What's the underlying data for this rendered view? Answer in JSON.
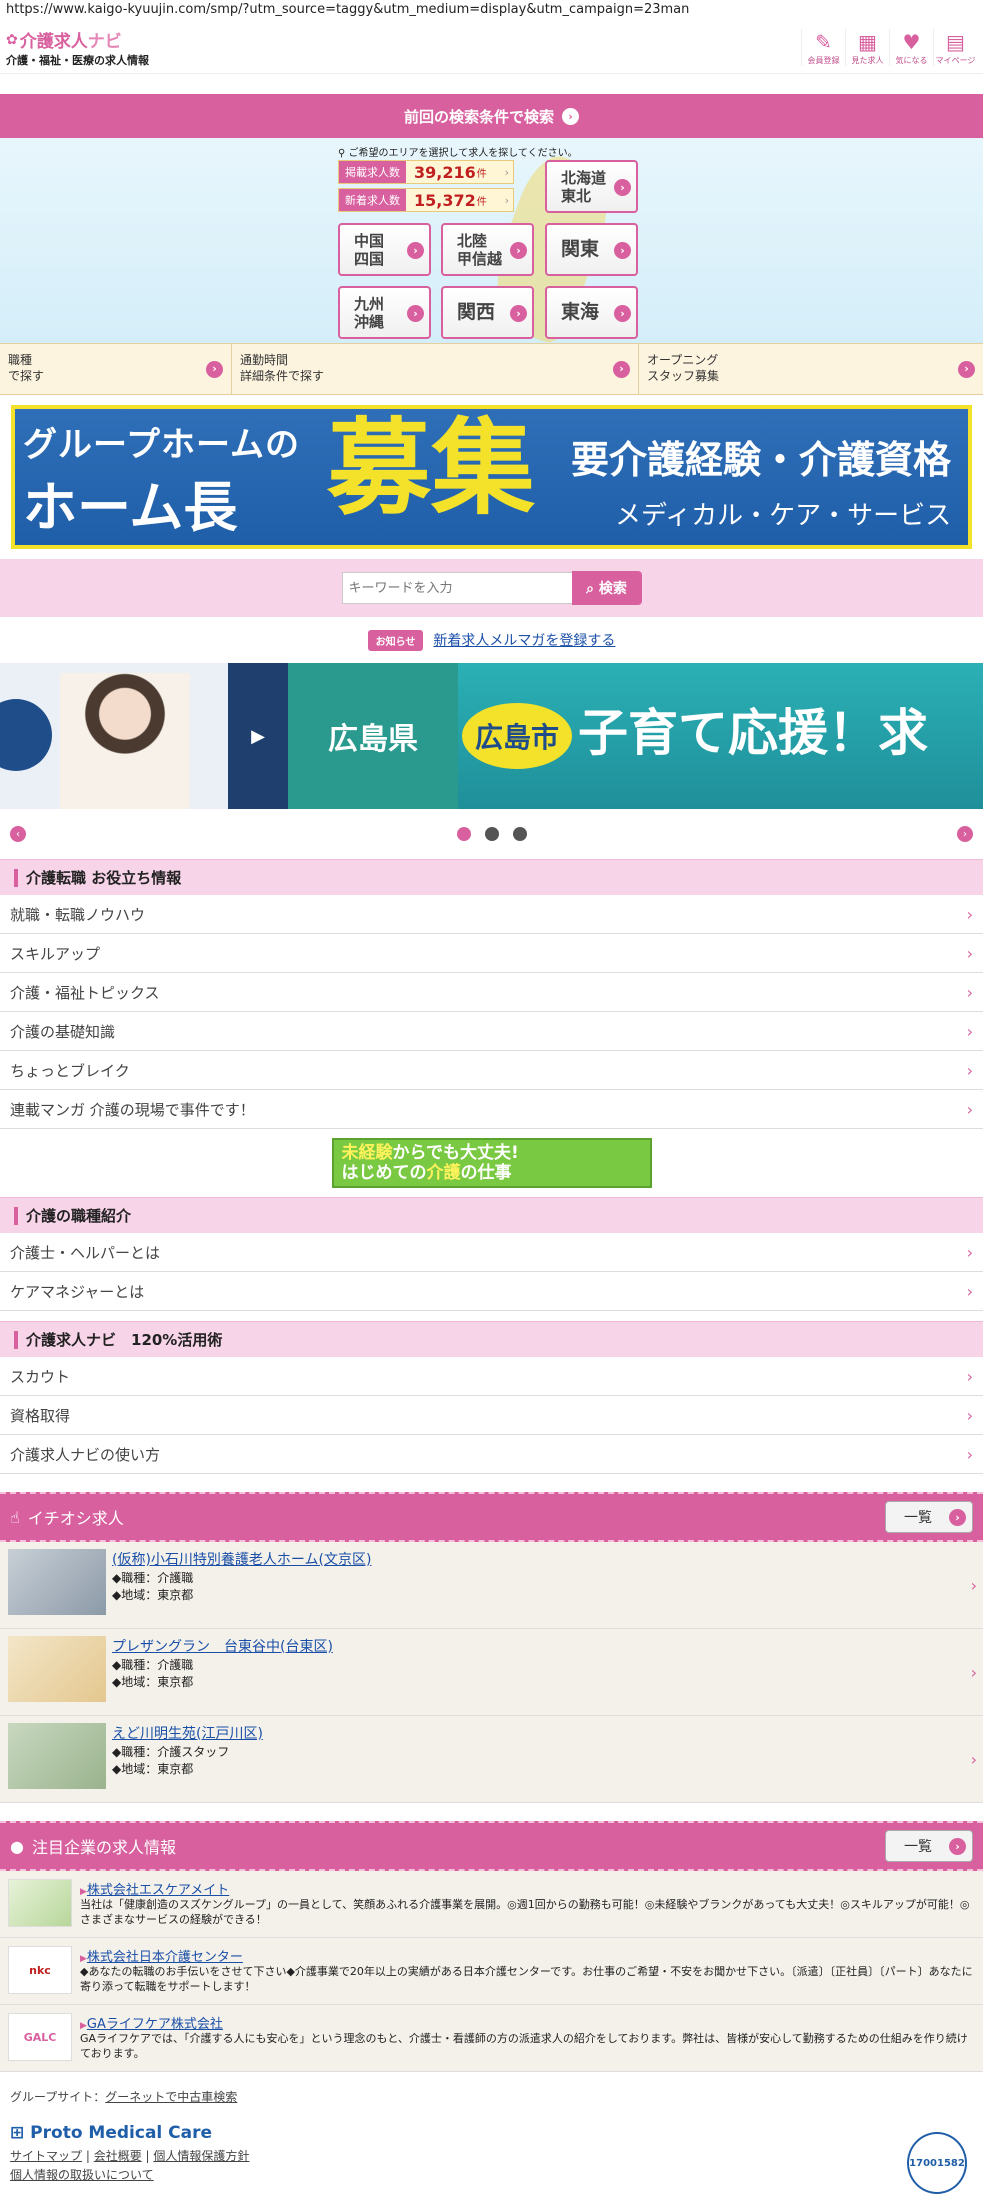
{
  "browser": {
    "url": "https://www.kaigo-kyuujin.com/smp/?utm_source=taggy&utm_medium=display&utm_campaign=23man"
  },
  "header": {
    "logo_main": "介護求人",
    "logo_navi": "ナビ",
    "logo_sub": "介護・福祉・医療の求人情報",
    "icons": [
      {
        "label": "会員登録",
        "icon": "pencil-icon"
      },
      {
        "label": "見た求人",
        "icon": "calendar-icon"
      },
      {
        "label": "気になる",
        "icon": "heart-icon"
      },
      {
        "label": "マイページ",
        "icon": "book-icon"
      }
    ]
  },
  "prev_search": {
    "label": "前回の検索条件で検索"
  },
  "area": {
    "hint": "ご希望のエリアを選択して求人を探してください。",
    "counts": [
      {
        "label": "掲載求人数",
        "value": "39,216",
        "unit": "件"
      },
      {
        "label": "新着求人数",
        "value": "15,372",
        "unit": "件"
      }
    ],
    "regions": {
      "hokkaido": "北海道\n東北",
      "chugoku": "中国\n四国",
      "hokuriku": "北陸\n甲信越",
      "kanto": "関東",
      "kyushu": "九州\n沖縄",
      "kansai": "関西",
      "tokai": "東海"
    }
  },
  "search_links": [
    "職種\nで探す",
    "通勤時間\n詳細条件で探す",
    "オープニング\nスタッフ募集"
  ],
  "banner": {
    "line1": "グループホームの",
    "line2": "ホーム長",
    "big": "募集",
    "req": "要介護経験・介護資格",
    "company": "メディカル・ケア・サービス"
  },
  "keyword": {
    "placeholder": "キーワードを入力",
    "button": "検索"
  },
  "notice": {
    "badge": "お知らせ",
    "link": "新着求人メルマガを登録する"
  },
  "carousel": {
    "pref": "広島県",
    "city": "広島市",
    "message": "子育て応援！求"
  },
  "sections": [
    {
      "title": "介護転職 お役立ち情報",
      "items": [
        "就職・転職ノウハウ",
        "スキルアップ",
        "介護・福祉トピックス",
        "介護の基礎知識",
        "ちょっとブレイク",
        "連載マンガ 介護の現場で事件です！"
      ]
    },
    {
      "title": "介護の職種紹介",
      "items": [
        "介護士・ヘルパーとは",
        "ケアマネジャーとは"
      ]
    },
    {
      "title": "介護求人ナビ　120%活用術",
      "items": [
        "スカウト",
        "資格取得",
        "介護求人ナビの使い方"
      ]
    }
  ],
  "mini_banner": {
    "line1a": "未経験",
    "line1b": "からでも大丈夫!",
    "line2a": "はじめての",
    "line2b": "介護",
    "line2c": "の仕事"
  },
  "featured": {
    "title": "イチオシ求人",
    "more": "一覧",
    "jobs": [
      {
        "title": "(仮称)小石川特別養護老人ホーム(文京区)",
        "occupation": "◆職種：介護職",
        "region": "◆地域：東京都"
      },
      {
        "title": "プレザングラン　台東谷中(台東区)",
        "occupation": "◆職種：介護職",
        "region": "◆地域：東京都"
      },
      {
        "title": "えど川明生苑(江戸川区)",
        "occupation": "◆職種：介護スタッフ",
        "region": "◆地域：東京都"
      }
    ]
  },
  "companies": {
    "title": "注目企業の求人情報",
    "more": "一覧",
    "items": [
      {
        "name": "株式会社エスケアメイト",
        "logo": "",
        "desc": "当社は「健康創造のスズケングループ」の一員として、笑顔あふれる介護事業を展開。◎週1回からの勤務も可能！◎未経験やブランクがあっても大丈夫！◎スキルアップが可能！◎さまざまなサービスの経験ができる！"
      },
      {
        "name": "株式会社日本介護センター",
        "logo": "nkc",
        "desc": "◆あなたの転職のお手伝いをさせて下さい◆介護事業で20年以上の実績がある日本介護センターです。お仕事のご希望・不安をお聞かせ下さい。〔派遣〕〔正社員〕〔パート〕あなたに寄り添って転職をサポートします！"
      },
      {
        "name": "GAライフケア株式会社",
        "logo": "GALC",
        "desc": "GAライフケアでは、「介護する人にも安心を」という理念のもと、介護士・看護師の方の派遣求人の紹介をしております。弊社は、皆様が安心して勤務するための仕組みを作り続けております。"
      }
    ]
  },
  "footer": {
    "group_label": "グループサイト：",
    "group_link": "グーネットで中古車検索",
    "brand": "Proto Medical Care",
    "links": [
      "サイトマップ",
      "会社概要",
      "個人情報保護方針",
      "個人情報の取扱いについて"
    ],
    "pmark_code": "17001582"
  },
  "colors": {
    "accent": "#d9609f",
    "light_pink": "#f8d4e8",
    "link": "#1a4fa8"
  }
}
